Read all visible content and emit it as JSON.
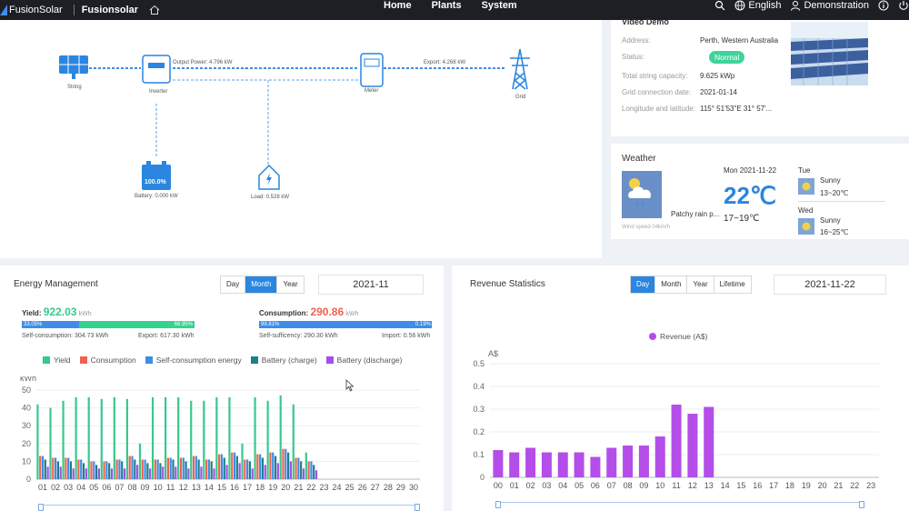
{
  "topbar": {
    "brand": "FusionSolar",
    "app": "Fusionsolar",
    "nav": [
      "Home",
      "Plants",
      "System"
    ],
    "language": "English",
    "user": "Demonstration"
  },
  "flow": {
    "string_label": "String",
    "inverter_label": "Inverter",
    "meter_label": "Meter",
    "grid_label": "Grid",
    "output_power": "Output Power: 4.796 kW",
    "export": "Export: 4.268 kW",
    "battery_soc": "100.0%",
    "battery_label": "Battery: 0.000 kW",
    "load_label": "Load: 0.528 kW"
  },
  "station": {
    "name": "Video Demo",
    "rows": [
      {
        "key": "Address:",
        "value": "Perth, Western Australia"
      },
      {
        "key": "Status:",
        "value": "Normal"
      },
      {
        "key": "Total string capacity:",
        "value": "9.625 kWp"
      },
      {
        "key": "Grid connection date:",
        "value": "2021-01-14"
      },
      {
        "key": "Longitude and latitude:",
        "value": "115° 51'53\"E    31° 57'..."
      }
    ],
    "status_color": "#3fd39b"
  },
  "weather": {
    "title": "Weather",
    "today_desc": "Patchy rain p...",
    "wind": "Wind speed 04km/h",
    "date": "Mon  2021-11-22",
    "temp": "22℃",
    "range": "17~19℃",
    "forecast": [
      {
        "day": "Tue",
        "desc": "Sunny",
        "range": "13~20℃"
      },
      {
        "day": "Wed",
        "desc": "Sunny",
        "range": "16~25℃"
      }
    ]
  },
  "energy": {
    "title": "Energy Management",
    "tabs": [
      "Day",
      "Month",
      "Year"
    ],
    "active_tab": "Month",
    "date": "2021-11",
    "yield_label": "Yield:",
    "yield_value": "922.03",
    "yield_unit": "kWh",
    "yield_self_pct": "33.05%",
    "yield_export_pct": "66.95%",
    "self_consumption": "Self-consumption: 304.73 kWh",
    "export": "Export: 617.30 kWh",
    "consumption_label": "Consumption:",
    "consumption_value": "290.86",
    "consumption_unit": "kWh",
    "self_suff_pct": "99.81%",
    "import_pct": "0.19%",
    "self_sufficiency": "Self-sufficency: 290.30 kWh",
    "import": "Import: 0.56 kWh"
  },
  "revenue": {
    "title": "Revenue Statistics",
    "tabs": [
      "Day",
      "Month",
      "Year",
      "Lifetime"
    ],
    "active_tab": "Day",
    "date": "2021-11-22"
  },
  "chart_data": [
    {
      "type": "bar",
      "ylabel": "kWh",
      "ylim": [
        0,
        50
      ],
      "yticks": [
        0,
        10,
        20,
        30,
        40,
        50
      ],
      "categories": [
        "01",
        "02",
        "03",
        "04",
        "05",
        "06",
        "07",
        "08",
        "09",
        "10",
        "11",
        "12",
        "13",
        "14",
        "15",
        "16",
        "17",
        "18",
        "19",
        "20",
        "21",
        "22",
        "23",
        "24",
        "25",
        "26",
        "27",
        "28",
        "29",
        "30"
      ],
      "series": [
        {
          "name": "Yield",
          "color": "#36c98c",
          "values": [
            42,
            40,
            44,
            46,
            46,
            45,
            46,
            45,
            20,
            46,
            46,
            46,
            44,
            44,
            46,
            46,
            20,
            46,
            44,
            47,
            42,
            15,
            null,
            null,
            null,
            null,
            null,
            null,
            null,
            null
          ]
        },
        {
          "name": "Consumption",
          "color": "#f06250",
          "values": [
            13,
            12,
            12,
            11,
            10,
            10,
            11,
            13,
            11,
            11,
            12,
            12,
            13,
            11,
            14,
            15,
            11,
            14,
            15,
            17,
            12,
            10,
            null,
            null,
            null,
            null,
            null,
            null,
            null,
            null
          ]
        },
        {
          "name": "Self-consumption energy",
          "color": "#3f8de6",
          "values": [
            13,
            12,
            12,
            11,
            10,
            10,
            11,
            13,
            11,
            11,
            12,
            12,
            13,
            11,
            14,
            15,
            11,
            14,
            15,
            17,
            12,
            10,
            null,
            null,
            null,
            null,
            null,
            null,
            null,
            null
          ]
        },
        {
          "name": "Battery (charge)",
          "color": "#1d7f8c",
          "values": [
            11,
            10,
            10,
            9,
            8,
            9,
            10,
            11,
            9,
            9,
            11,
            10,
            11,
            10,
            12,
            13,
            10,
            12,
            13,
            15,
            10,
            8,
            null,
            null,
            null,
            null,
            null,
            null,
            null,
            null
          ]
        },
        {
          "name": "Battery (discharge)",
          "color": "#a64ee8",
          "values": [
            7,
            7,
            6,
            6,
            6,
            6,
            6,
            8,
            6,
            7,
            7,
            6,
            7,
            6,
            8,
            9,
            6,
            8,
            9,
            10,
            6,
            5,
            null,
            null,
            null,
            null,
            null,
            null,
            null,
            null
          ]
        }
      ]
    },
    {
      "type": "bar",
      "ylabel": "A$",
      "ylim": [
        0,
        0.5
      ],
      "yticks": [
        0,
        0.1,
        0.2,
        0.3,
        0.4,
        0.5
      ],
      "categories": [
        "00",
        "01",
        "02",
        "03",
        "04",
        "05",
        "06",
        "07",
        "08",
        "09",
        "10",
        "11",
        "12",
        "13",
        "14",
        "15",
        "16",
        "17",
        "18",
        "19",
        "20",
        "21",
        "22",
        "23"
      ],
      "series": [
        {
          "name": "Revenue (A$)",
          "color": "#b44de9",
          "values": [
            0.12,
            0.11,
            0.13,
            0.11,
            0.11,
            0.11,
            0.09,
            0.13,
            0.14,
            0.14,
            0.18,
            0.32,
            0.28,
            0.31,
            null,
            null,
            null,
            null,
            null,
            null,
            null,
            null,
            null,
            null
          ]
        }
      ]
    }
  ]
}
